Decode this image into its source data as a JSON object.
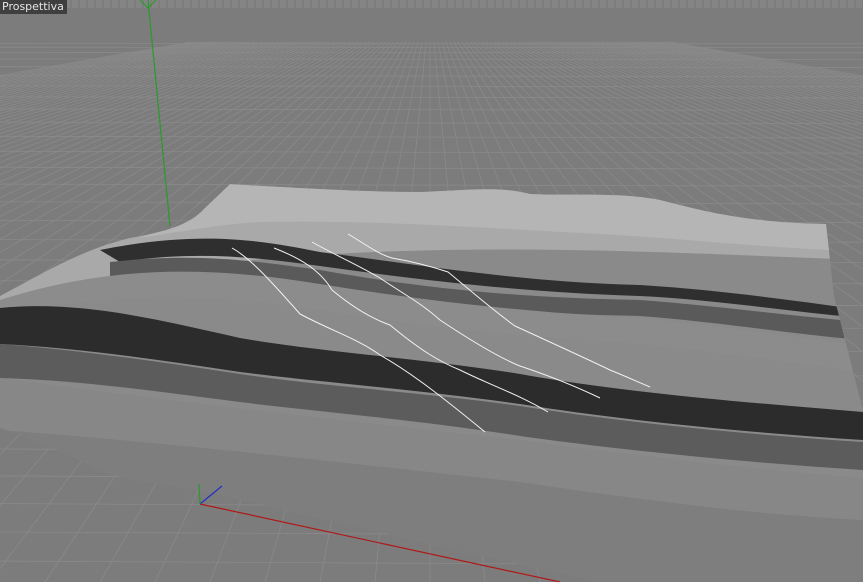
{
  "viewport": {
    "label": "Prospettiva"
  },
  "scene": {
    "background_color": "#7c7c7c",
    "grid_color": "#8a8a8a",
    "surface_light_color": "#a8a8a8",
    "surface_dark_color": "#2c2c2c",
    "curve_color": "#f2f2f2",
    "axes": {
      "x_color": "#b01818",
      "y_color": "#2a9a2a",
      "z_color": "#2030c0"
    },
    "spline_count": 4
  }
}
